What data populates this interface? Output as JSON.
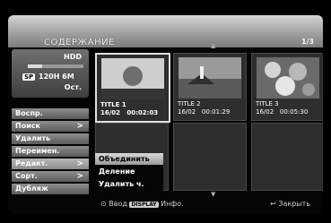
{
  "header": {
    "title": "СОДЕРЖАНИЕ",
    "page": "1/3"
  },
  "disk": {
    "label": "HDD",
    "mode": "SP",
    "remaining": "120H 6M",
    "remaining_label": "Ост.",
    "usage_fraction": 0.25
  },
  "menu": {
    "items": [
      {
        "label": "Воспр.",
        "arrow": ""
      },
      {
        "label": "Поиск",
        "arrow": ">"
      },
      {
        "label": "Удалить",
        "arrow": ""
      },
      {
        "label": "Переимен.",
        "arrow": ""
      },
      {
        "label": "Редакт.",
        "arrow": ">"
      },
      {
        "label": "Сорт.",
        "arrow": ">"
      },
      {
        "label": "Дубляж",
        "arrow": ""
      }
    ]
  },
  "submenu": {
    "items": [
      {
        "label": "Объединить",
        "selected": true
      },
      {
        "label": "Деление",
        "selected": false
      },
      {
        "label": "Удалить ч.",
        "selected": false
      }
    ]
  },
  "titles": [
    {
      "name": "TITLE 1",
      "date": "16/02",
      "duration": "00:02:03",
      "thumb": "sun-icon",
      "selected": true
    },
    {
      "name": "TITLE 2",
      "date": "16/02",
      "duration": "00:01:29",
      "thumb": "lighthouse-icon",
      "selected": false
    },
    {
      "name": "TITLE 3",
      "date": "16/02",
      "duration": "00:05:30",
      "thumb": "flowers-icon",
      "selected": false
    }
  ],
  "footer": {
    "enter": "Ввод",
    "display_button": "DISPLAY",
    "info": "Инфо.",
    "close": "Закрыть"
  }
}
